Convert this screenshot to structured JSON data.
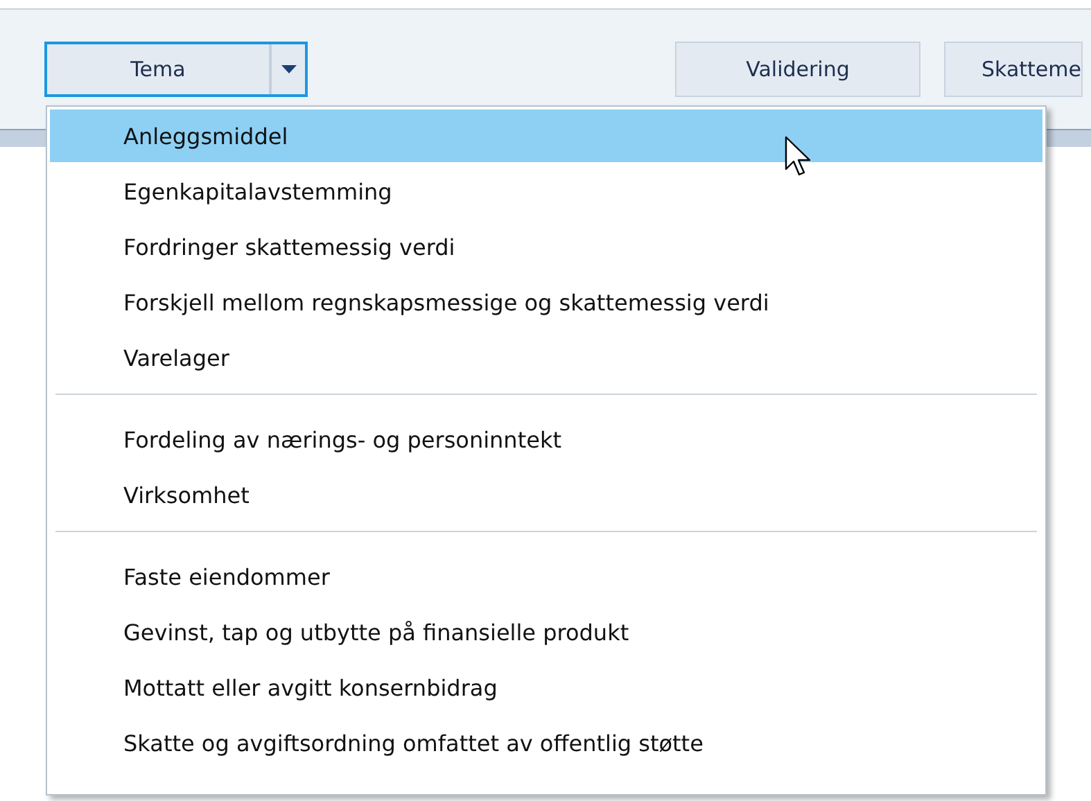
{
  "toolbar": {
    "split_button": {
      "label": "Tema",
      "focused": true
    },
    "buttons": [
      "Validering",
      "Skatteme"
    ]
  },
  "menu": {
    "groups": [
      {
        "items": [
          {
            "label": "Anleggsmiddel",
            "selected": true
          },
          {
            "label": "Egenkapitalavstemming",
            "selected": false
          },
          {
            "label": "Fordringer skattemessig verdi",
            "selected": false
          },
          {
            "label": "Forskjell mellom regnskapsmessige og skattemessig verdi",
            "selected": false
          },
          {
            "label": "Varelager",
            "selected": false
          }
        ]
      },
      {
        "items": [
          {
            "label": "Fordeling av nærings- og personinntekt",
            "selected": false
          },
          {
            "label": "Virksomhet",
            "selected": false
          }
        ]
      },
      {
        "items": [
          {
            "label": "Faste eiendommer",
            "selected": false
          },
          {
            "label": "Gevinst, tap og utbytte på finansielle produkt",
            "selected": false
          },
          {
            "label": "Mottatt eller avgitt konsernbidrag",
            "selected": false
          },
          {
            "label": "Skatte og avgiftsordning omfattet av offentlig støtte",
            "selected": false
          }
        ]
      }
    ]
  }
}
